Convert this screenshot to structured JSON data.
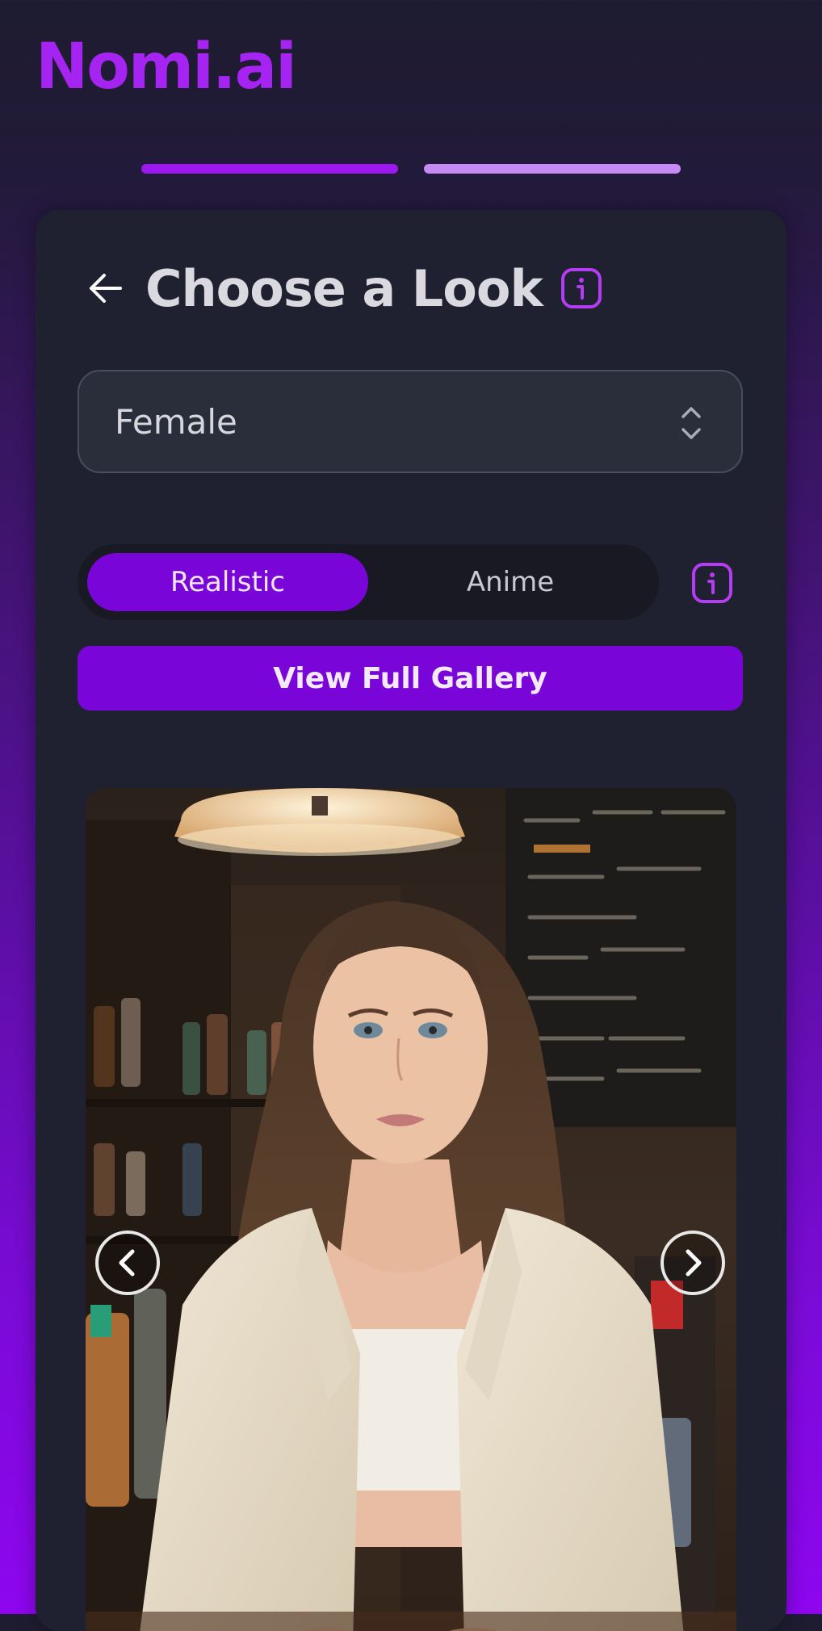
{
  "app": {
    "brand": "Nomi.ai",
    "accent": "#a524f2",
    "steps": {
      "total": 2,
      "current": 1
    }
  },
  "header": {
    "back_icon": "arrow-left-icon",
    "title": "Choose a Look",
    "info_icon": "info-icon"
  },
  "gender_select": {
    "value": "Female",
    "icon": "chevron-up-down-icon"
  },
  "style_toggle": {
    "options": [
      "Realistic",
      "Anime"
    ],
    "selected": "Realistic",
    "info_icon": "info-icon"
  },
  "gallery_button": {
    "label": "View Full Gallery"
  },
  "carousel": {
    "image_alt_icon": "portrait-photo",
    "prev_icon": "chevron-left-icon",
    "next_icon": "chevron-right-icon"
  },
  "colors": {
    "primary": "#7a05d8",
    "card": "#202130",
    "text": "#d9d9df"
  }
}
